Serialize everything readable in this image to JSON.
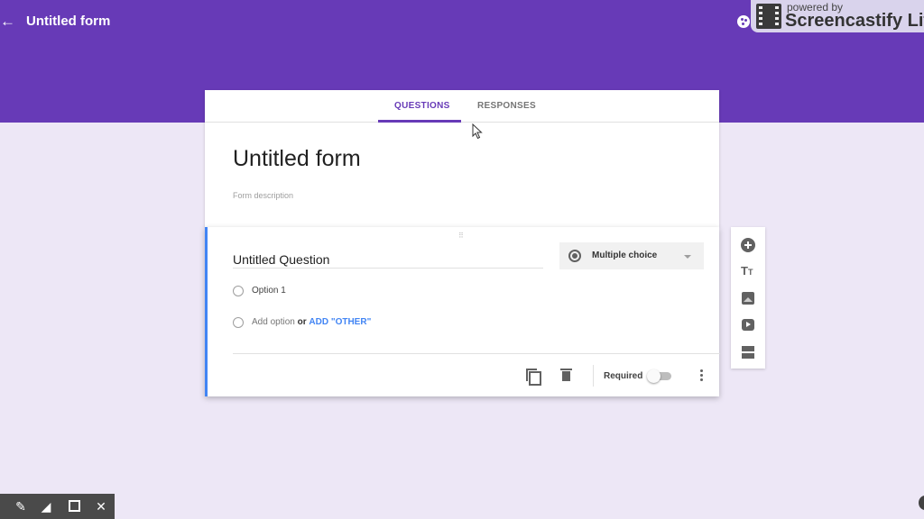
{
  "header": {
    "back_icon": "arrow-left-icon",
    "back_glyph": "←",
    "title": "Untitled form",
    "palette_icon": "palette-icon"
  },
  "recorder_badge": {
    "powered_by": "powered by",
    "name": "Screencastify Lit"
  },
  "tabs": [
    {
      "label": "QUESTIONS",
      "active": true
    },
    {
      "label": "RESPONSES",
      "active": false
    }
  ],
  "form": {
    "title": "Untitled form",
    "description_placeholder": "Form description"
  },
  "question": {
    "drag_handle": "⠿",
    "title": "Untitled Question",
    "type": "Multiple choice",
    "options": [
      {
        "label": "Option 1"
      }
    ],
    "add_option_label": "Add option",
    "or_label": "or",
    "add_other_label": "ADD \"OTHER\"",
    "required_label": "Required",
    "required_on": false
  },
  "side_toolbar": [
    {
      "name": "add-question",
      "icon": "add-circle-icon"
    },
    {
      "name": "add-title",
      "icon": "title-icon",
      "glyph_big": "T",
      "glyph_small": "T"
    },
    {
      "name": "add-image",
      "icon": "image-icon"
    },
    {
      "name": "add-video",
      "icon": "video-icon"
    },
    {
      "name": "add-section",
      "icon": "section-icon"
    }
  ],
  "draw_toolbar": {
    "pen": "✎",
    "eraser": "◢",
    "close": "✕"
  },
  "colors": {
    "brand": "#673ab7",
    "background": "#ede7f6",
    "accent_link": "#4285f4"
  }
}
